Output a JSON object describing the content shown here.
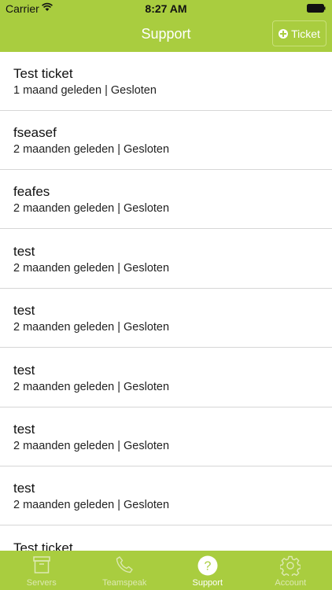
{
  "status_bar": {
    "carrier": "Carrier",
    "time": "8:27 AM"
  },
  "nav": {
    "title": "Support",
    "new_ticket_label": "Ticket",
    "accent_color": "#a9cd3f"
  },
  "tickets": [
    {
      "title": "Test ticket",
      "meta": "1 maand geleden | Gesloten"
    },
    {
      "title": "fseasef",
      "meta": "2 maanden geleden | Gesloten"
    },
    {
      "title": "feafes",
      "meta": "2 maanden geleden | Gesloten"
    },
    {
      "title": "test",
      "meta": "2 maanden geleden | Gesloten"
    },
    {
      "title": "test",
      "meta": "2 maanden geleden | Gesloten"
    },
    {
      "title": "test",
      "meta": "2 maanden geleden | Gesloten"
    },
    {
      "title": "test",
      "meta": "2 maanden geleden | Gesloten"
    },
    {
      "title": "test",
      "meta": "2 maanden geleden | Gesloten"
    },
    {
      "title": "Test ticket",
      "meta": ""
    }
  ],
  "tabbar": {
    "tabs": [
      {
        "label": "Servers",
        "icon": "archive-box-icon"
      },
      {
        "label": "Teamspeak",
        "icon": "phone-icon"
      },
      {
        "label": "Support",
        "icon": "question-circle-icon",
        "active": true
      },
      {
        "label": "Account",
        "icon": "gear-icon"
      }
    ]
  }
}
